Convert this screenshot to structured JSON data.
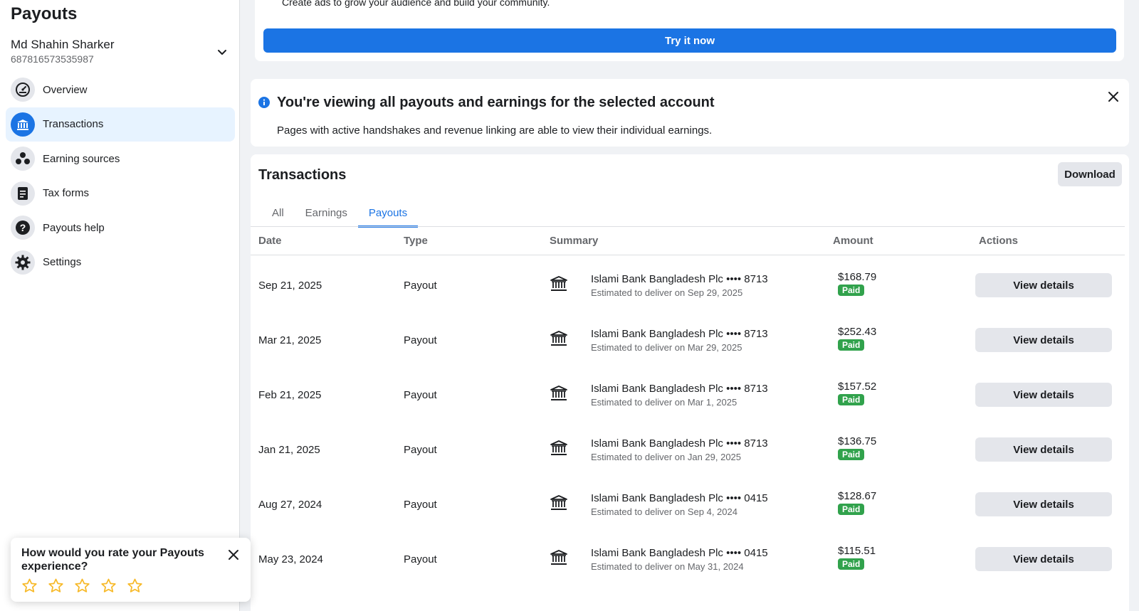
{
  "sidebar": {
    "title": "Payouts",
    "account": {
      "name": "Md Shahin Sharker",
      "id": "687816573535987"
    },
    "items": [
      {
        "label": "Overview",
        "icon": "gauge-icon"
      },
      {
        "label": "Transactions",
        "icon": "bank-icon",
        "active": true
      },
      {
        "label": "Earning sources",
        "icon": "network-icon"
      },
      {
        "label": "Tax forms",
        "icon": "document-icon"
      },
      {
        "label": "Payouts help",
        "icon": "question-icon"
      },
      {
        "label": "Settings",
        "icon": "gear-icon"
      }
    ]
  },
  "promo": {
    "text": "Create ads to grow your audience and build your community.",
    "button": "Try it now"
  },
  "notice": {
    "title": "You're viewing all payouts and earnings for the selected account",
    "subtitle": "Pages with active handshakes and revenue linking are able to view their individual earnings."
  },
  "transactions": {
    "title": "Transactions",
    "download": "Download",
    "tabs": [
      "All",
      "Earnings",
      "Payouts"
    ],
    "active_tab": "Payouts",
    "columns": [
      "Date",
      "Type",
      "Summary",
      "Amount",
      "Actions"
    ],
    "rows": [
      {
        "date": "Sep 21, 2025",
        "type": "Payout",
        "bank": "Islami Bank Bangladesh Plc •••• 8713",
        "deliver": "Estimated to deliver on Sep 29, 2025",
        "amount": "$168.79",
        "status": "Paid",
        "action": "View details"
      },
      {
        "date": "Mar 21, 2025",
        "type": "Payout",
        "bank": "Islami Bank Bangladesh Plc •••• 8713",
        "deliver": "Estimated to deliver on Mar 29, 2025",
        "amount": "$252.43",
        "status": "Paid",
        "action": "View details"
      },
      {
        "date": "Feb 21, 2025",
        "type": "Payout",
        "bank": "Islami Bank Bangladesh Plc •••• 8713",
        "deliver": "Estimated to deliver on Mar 1, 2025",
        "amount": "$157.52",
        "status": "Paid",
        "action": "View details"
      },
      {
        "date": "Jan 21, 2025",
        "type": "Payout",
        "bank": "Islami Bank Bangladesh Plc •••• 8713",
        "deliver": "Estimated to deliver on Jan 29, 2025",
        "amount": "$136.75",
        "status": "Paid",
        "action": "View details"
      },
      {
        "date": "Aug 27, 2024",
        "type": "Payout",
        "bank": "Islami Bank Bangladesh Plc •••• 0415",
        "deliver": "Estimated to deliver on Sep 4, 2024",
        "amount": "$128.67",
        "status": "Paid",
        "action": "View details"
      },
      {
        "date": "May 23, 2024",
        "type": "Payout",
        "bank": "Islami Bank Bangladesh Plc •••• 0415",
        "deliver": "Estimated to deliver on May 31, 2024",
        "amount": "$115.51",
        "status": "Paid",
        "action": "View details"
      }
    ]
  },
  "rating": {
    "question": "How would you rate your Payouts experience?",
    "stars": 5
  },
  "colors": {
    "accent": "#1b74e4",
    "paid": "#31a24c",
    "star": "#f7b928"
  }
}
